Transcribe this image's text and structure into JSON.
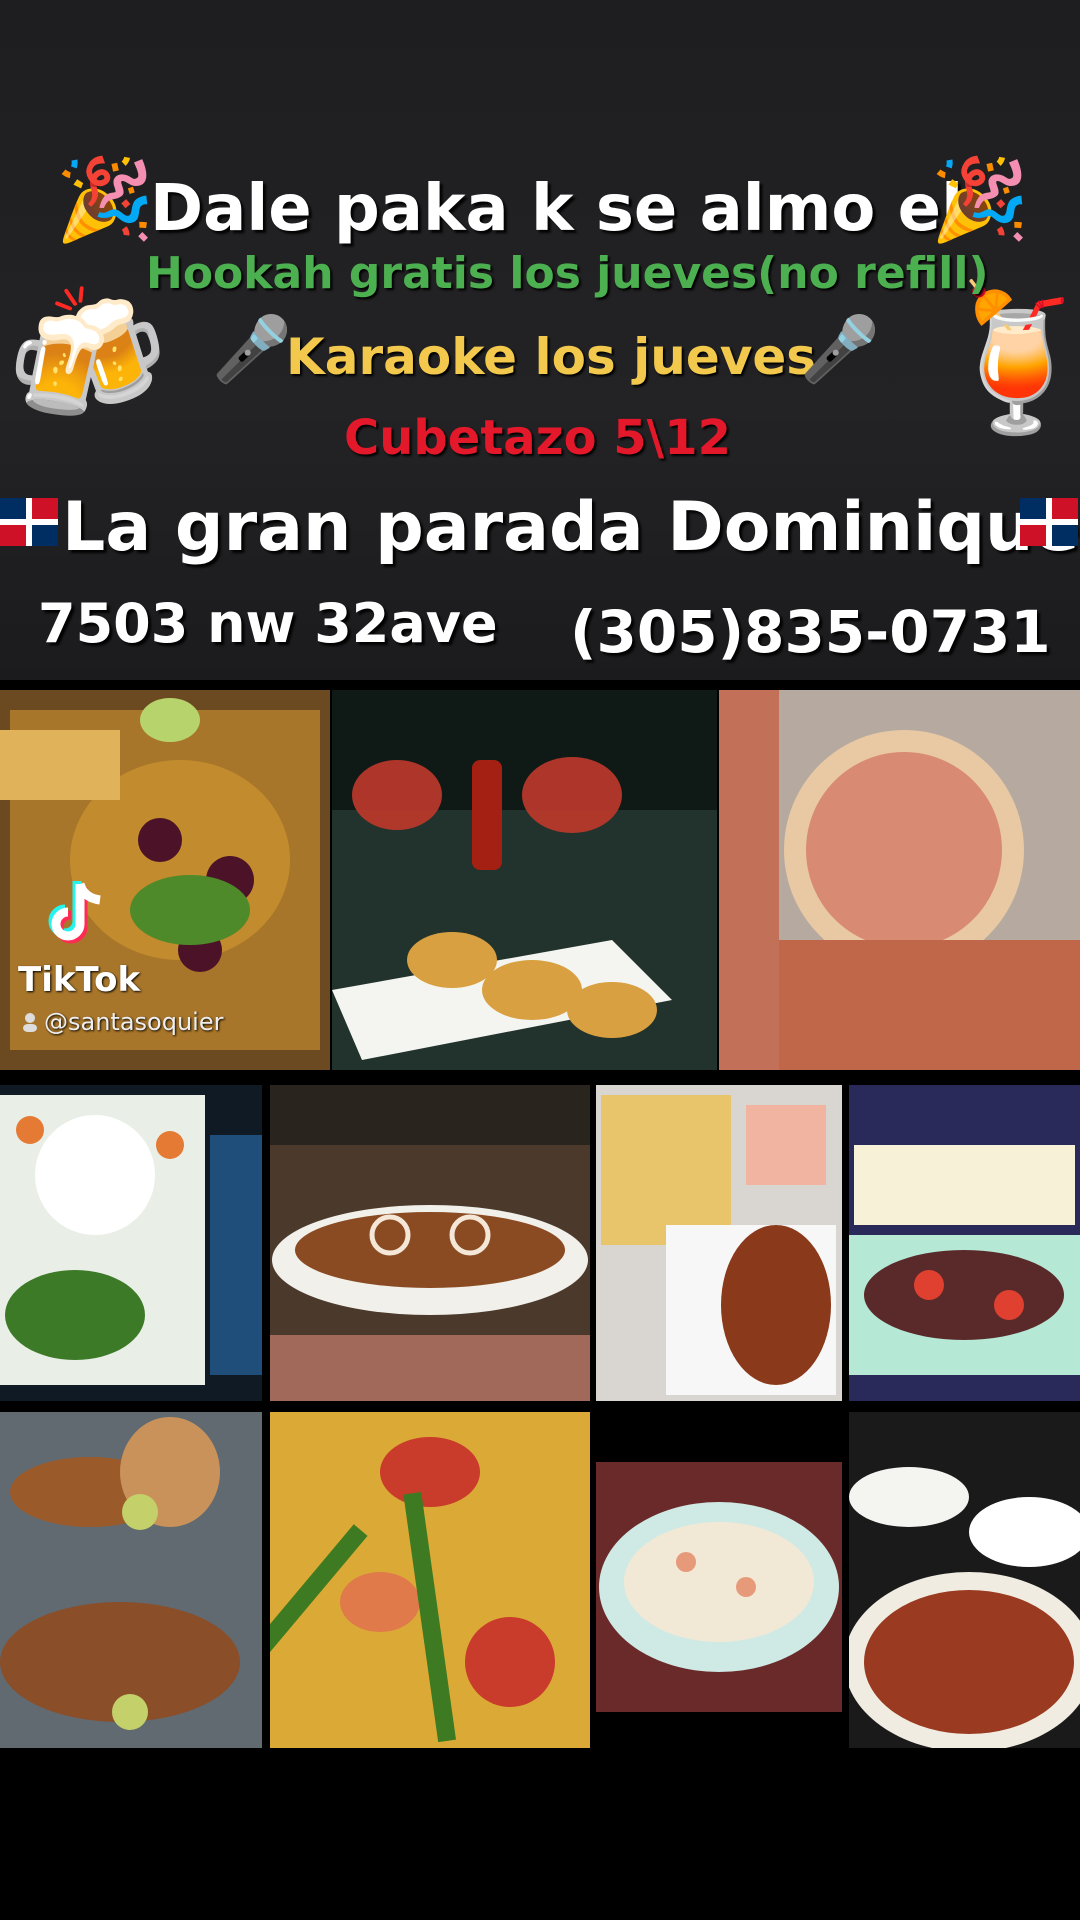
{
  "headline": "Dale paka k se almo el",
  "promo_hookah": "Hookah gratis los jueves(no refill)",
  "promo_karaoke": "Karaoke los jueves",
  "promo_cubetazo": "Cubetazo 5\\12",
  "venue_name": "La gran parada Dominique",
  "address": "7503 nw 32ave",
  "phone": "(305)835-0731",
  "watermark": {
    "brand": "TikTok",
    "handle": "@santasoquier"
  },
  "icons": [
    "party-popper-icon",
    "beer-mugs-icon",
    "microphone-icon",
    "tropical-cocktail-icon",
    "dominican-flag-icon"
  ],
  "colors": {
    "green": "#4caf50",
    "yellow": "#f2c94c",
    "red": "#e3192b",
    "white": "#ffffff"
  }
}
